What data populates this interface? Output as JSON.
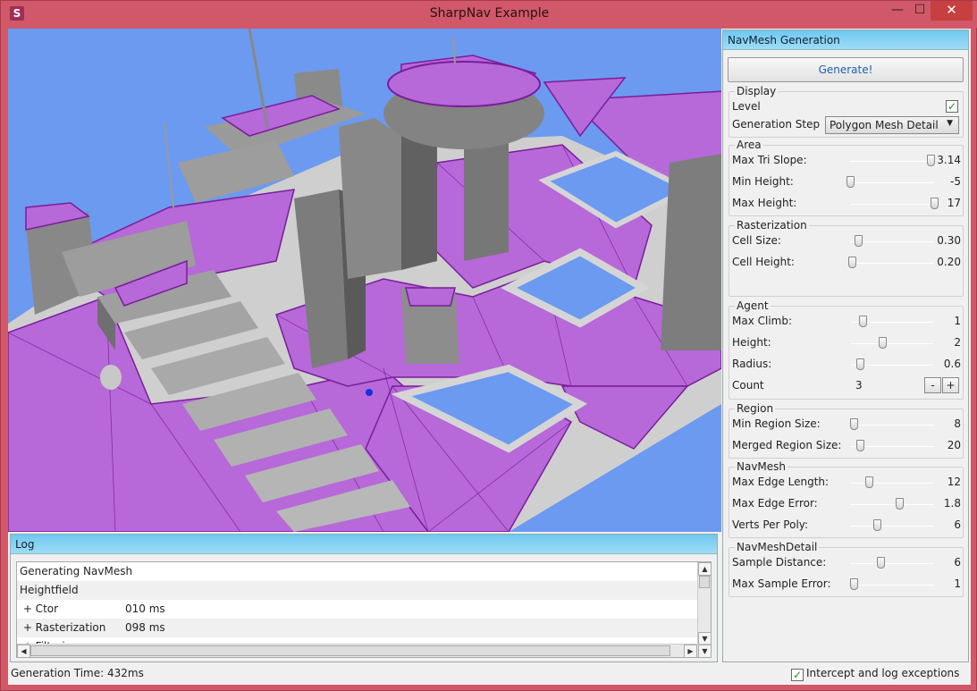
{
  "window": {
    "title": "SharpNav Example",
    "icon": "sharpnav-logo-icon",
    "minimize_glyph": "—",
    "maximize_glyph": "☐",
    "close_glyph": "✕"
  },
  "panel": {
    "header": "NavMesh Generation",
    "generate_label": "Generate!",
    "display": {
      "title": "Display",
      "level_label": "Level",
      "level_checked": true,
      "check_glyph": "✓",
      "generation_step_label": "Generation Step",
      "generation_step_value": "Polygon Mesh Detail",
      "dropdown_arrow": "▼"
    },
    "area": {
      "title": "Area",
      "sliders": [
        {
          "label": "Max Tri Slope:",
          "value": "3.14",
          "fraction": 0.96
        },
        {
          "label": "Min Height:",
          "value": "-5",
          "fraction": 0.0
        },
        {
          "label": "Max Height:",
          "value": "17",
          "fraction": 1.0
        }
      ]
    },
    "rasterization": {
      "title": "Rasterization",
      "sliders": [
        {
          "label": "Cell Size:",
          "value": "0.30",
          "fraction": 0.1
        },
        {
          "label": "Cell Height:",
          "value": "0.20",
          "fraction": 0.02
        }
      ]
    },
    "agent": {
      "title": "Agent",
      "sliders": [
        {
          "label": "Max Climb:",
          "value": "1",
          "fraction": 0.15
        },
        {
          "label": "Height:",
          "value": "2",
          "fraction": 0.38
        },
        {
          "label": "Radius:",
          "value": "0.6",
          "fraction": 0.12
        }
      ],
      "count_label": "Count",
      "count_value": "3",
      "minus_label": "-",
      "plus_label": "+"
    },
    "region": {
      "title": "Region",
      "sliders": [
        {
          "label": "Min Region Size:",
          "value": "8",
          "fraction": 0.04
        },
        {
          "label": "Merged Region Size:",
          "value": "20",
          "fraction": 0.12
        }
      ]
    },
    "navmesh": {
      "title": "NavMesh",
      "sliders": [
        {
          "label": "Max Edge Length:",
          "value": "12",
          "fraction": 0.22
        },
        {
          "label": "Max Edge Error:",
          "value": "1.8",
          "fraction": 0.58
        },
        {
          "label": "Verts Per Poly:",
          "value": "6",
          "fraction": 0.32
        }
      ]
    },
    "navmesh_detail": {
      "title": "NavMeshDetail",
      "sliders": [
        {
          "label": "Sample Distance:",
          "value": "6",
          "fraction": 0.36
        },
        {
          "label": "Max Sample Error:",
          "value": "1",
          "fraction": 0.04
        }
      ]
    }
  },
  "log": {
    "header": "Log",
    "rows": [
      {
        "text": "Generating NavMesh",
        "time": ""
      },
      {
        "text": "Heightfield",
        "time": ""
      },
      {
        "text": " + Ctor",
        "time": "010 ms"
      },
      {
        "text": " + Rasterization",
        "time": "098 ms"
      },
      {
        "text": " + Filtering",
        "time": ""
      }
    ],
    "up_arrow": "▲",
    "down_arrow": "▼",
    "left_arrow": "◀",
    "right_arrow": "▶"
  },
  "status": {
    "generation_time": "Generation Time: 432ms",
    "intercept_label": "Intercept and log exceptions",
    "intercept_checked": true
  },
  "colors": {
    "sky": "#6b9af0",
    "navmesh": "#b768d9",
    "navmesh_edge": "#7a1d9a",
    "geometry": "#8a8a8a",
    "header_gradient": "#6ec7f0",
    "titlebar": "#d05868"
  }
}
